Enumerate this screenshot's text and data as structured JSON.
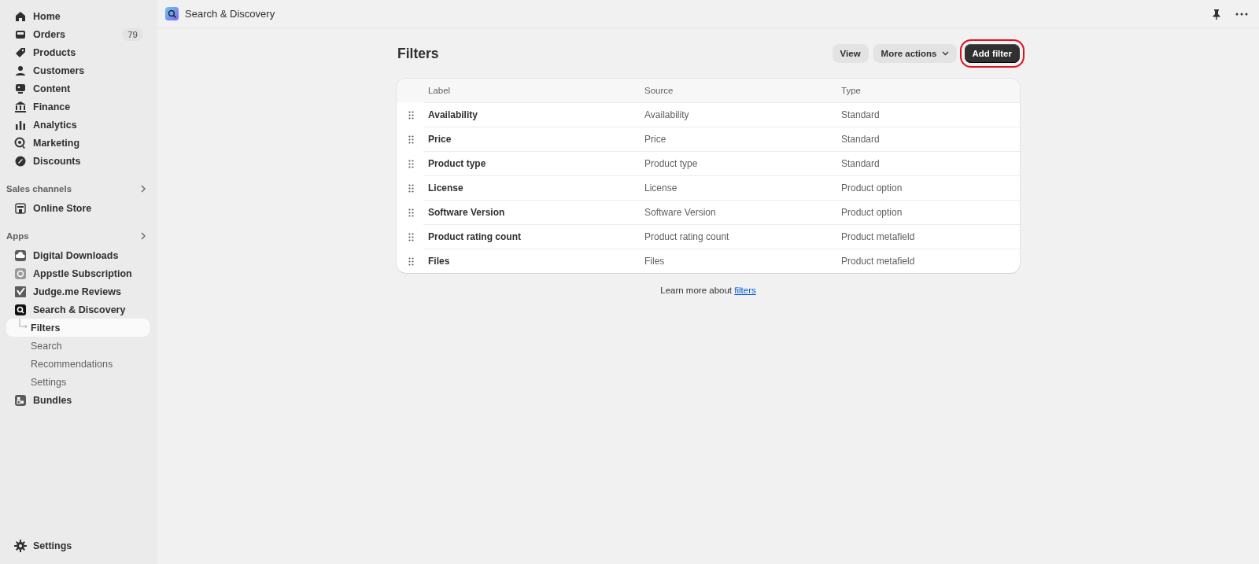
{
  "sidebar": {
    "main_items": [
      {
        "label": "Home",
        "selected": false
      },
      {
        "label": "Orders",
        "badge": "79",
        "selected": false
      },
      {
        "label": "Products",
        "selected": false
      },
      {
        "label": "Customers",
        "selected": false
      },
      {
        "label": "Content",
        "selected": false
      },
      {
        "label": "Finance",
        "selected": false
      },
      {
        "label": "Analytics",
        "selected": false
      },
      {
        "label": "Marketing",
        "selected": false
      },
      {
        "label": "Discounts",
        "selected": false
      }
    ],
    "sections": [
      {
        "title": "Sales channels",
        "items": [
          {
            "label": "Online Store",
            "selected": false
          }
        ]
      },
      {
        "title": "Apps",
        "items": [
          {
            "label": "Digital Downloads",
            "selected": false
          },
          {
            "label": "Appstle Subscription",
            "selected": false
          },
          {
            "label": "Judge.me Reviews",
            "selected": false
          },
          {
            "label": "Search & Discovery",
            "selected": false,
            "children": [
              {
                "label": "Filters",
                "selected": true
              },
              {
                "label": "Search",
                "selected": false
              },
              {
                "label": "Recommendations",
                "selected": false
              },
              {
                "label": "Settings",
                "selected": false
              }
            ]
          },
          {
            "label": "Bundles",
            "selected": false
          }
        ]
      }
    ],
    "footer_item": {
      "label": "Settings"
    }
  },
  "top_bar": {
    "app_title": "Search & Discovery"
  },
  "page": {
    "title": "Filters",
    "actions": [
      {
        "label": "View",
        "kind": "secondary",
        "highlighted": false
      },
      {
        "label": "More actions",
        "kind": "menu",
        "highlighted": false
      },
      {
        "label": "Add filter",
        "kind": "primary",
        "highlighted": true
      }
    ],
    "table": {
      "columns": [
        "Label",
        "Source",
        "Type"
      ],
      "rows": [
        [
          "Availability",
          "Availability",
          "Standard"
        ],
        [
          "Price",
          "Price",
          "Standard"
        ],
        [
          "Product type",
          "Product type",
          "Standard"
        ],
        [
          "License",
          "License",
          "Product option"
        ],
        [
          "Software Version",
          "Software Version",
          "Product option"
        ],
        [
          "Product rating count",
          "Product rating count",
          "Product metafield"
        ],
        [
          "Files",
          "Files",
          "Product metafield"
        ]
      ]
    },
    "footer_text": "Learn more about ",
    "footer_link": "filters"
  }
}
